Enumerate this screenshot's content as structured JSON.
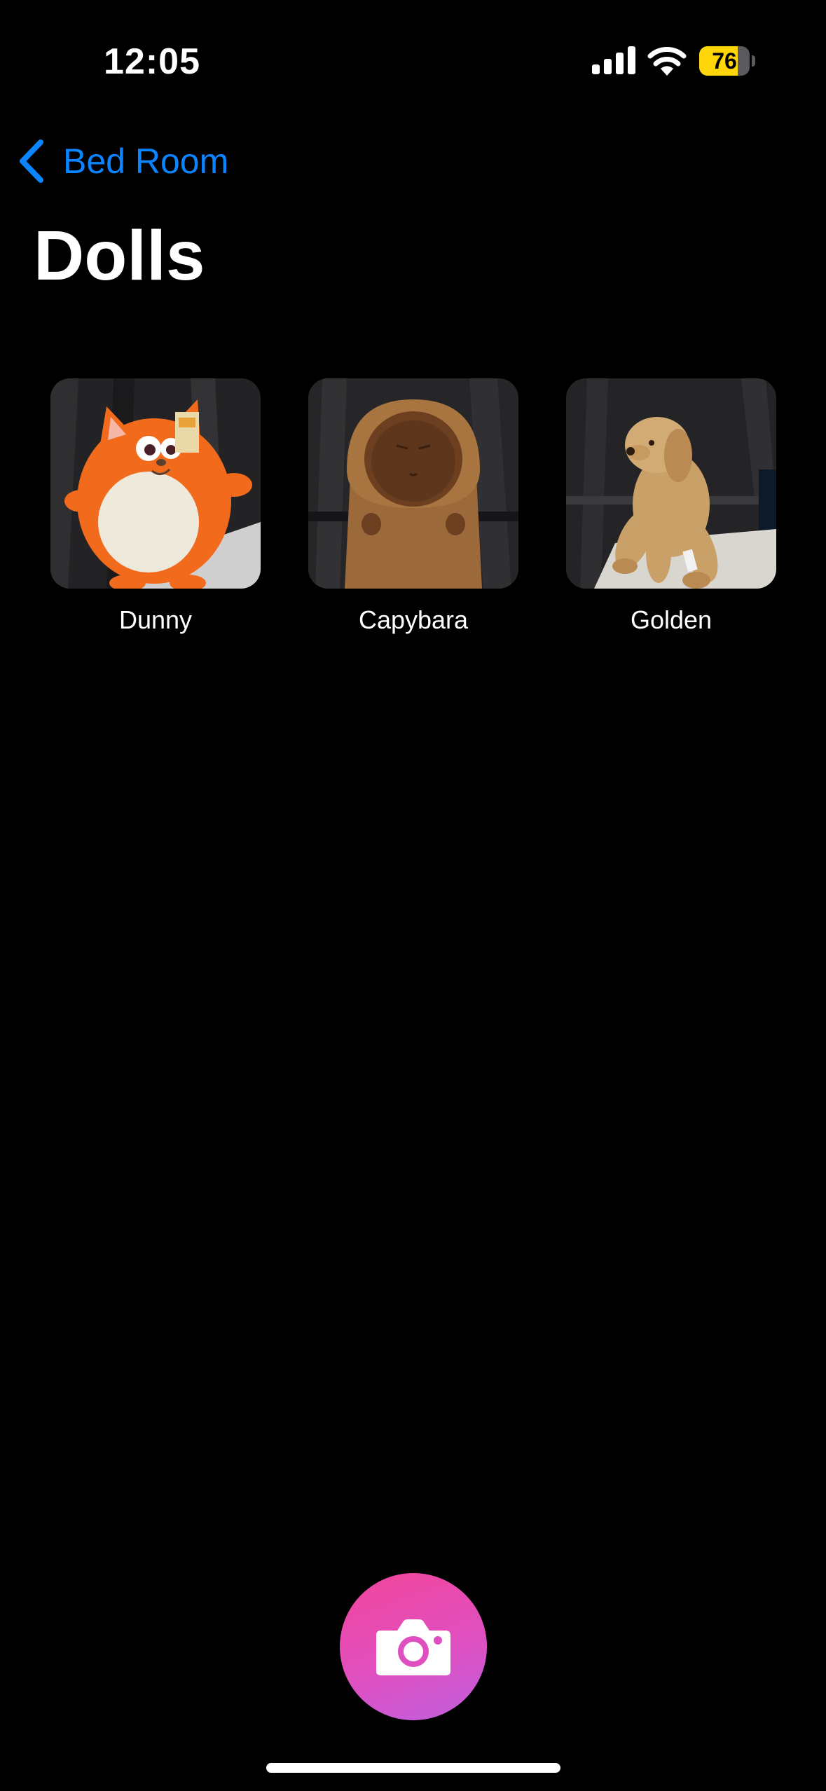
{
  "status_bar": {
    "time": "12:05",
    "battery_level": "76",
    "battery_fraction": 0.76,
    "icons": [
      "signal-icon",
      "wifi-icon",
      "battery-icon"
    ]
  },
  "nav": {
    "back_label": "Bed Room",
    "back_icon": "chevron-left-icon",
    "title": "Dolls"
  },
  "items": [
    {
      "label": "Dunny",
      "thumbnail": "orange plush toy"
    },
    {
      "label": "Capybara",
      "thumbnail": "brown capybara plush"
    },
    {
      "label": "Golden",
      "thumbnail": "golden retriever plush"
    }
  ],
  "camera_button": {
    "icon": "camera-icon"
  },
  "colors": {
    "background": "#000000",
    "accent": "#0a84ff",
    "battery": "#ffd60a",
    "camera_gradient_start": "#f2459a",
    "camera_gradient_end": "#c060e0"
  }
}
